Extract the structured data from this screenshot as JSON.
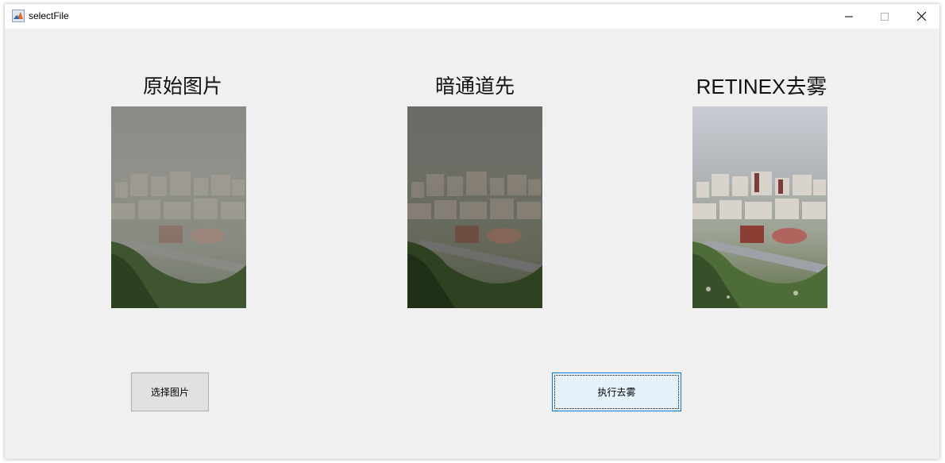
{
  "window": {
    "title": "selectFile",
    "icon": "matlab-icon",
    "controls": [
      "minimize-icon",
      "maximize-icon",
      "close-icon"
    ]
  },
  "panels": [
    {
      "label": "原始图片",
      "image": "hazy-city-original"
    },
    {
      "label": "暗通道先",
      "image": "city-dark-channel-prior"
    },
    {
      "label": "RETINEX去雾",
      "image": "city-retinex-dehazed"
    }
  ],
  "buttons": {
    "select_label": "选择图片",
    "run_label": "执行去雾"
  },
  "colors": {
    "window_bg": "#f0f0f0",
    "focused_button_bg": "#e5f1fb",
    "focused_button_border": "#0078d7"
  }
}
